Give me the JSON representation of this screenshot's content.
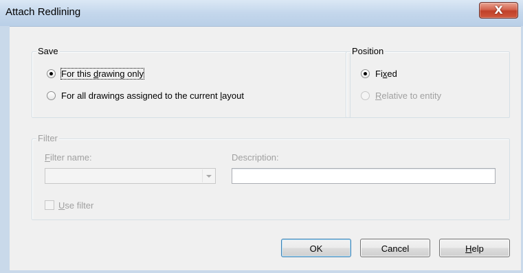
{
  "window": {
    "title": "Attach Redlining",
    "close_glyph": "X"
  },
  "save_group": {
    "legend": "Save",
    "option1": {
      "prefix": "For this ",
      "accel": "d",
      "suffix": "rawing only",
      "checked": true
    },
    "option2": {
      "prefix": "For all drawings assigned to the current ",
      "accel": "l",
      "suffix": "ayout",
      "checked": false
    }
  },
  "position_group": {
    "legend": "Position",
    "option1": {
      "prefix": "Fi",
      "accel": "x",
      "suffix": "ed",
      "checked": true,
      "enabled": true
    },
    "option2": {
      "prefix": "",
      "accel": "R",
      "suffix": "elative to entity",
      "checked": false,
      "enabled": false
    }
  },
  "filter_group": {
    "legend": "Filter",
    "filter_name_label": {
      "accel": "F",
      "suffix": "ilter name:"
    },
    "filter_name_value": "",
    "description_label": "Description:",
    "description_value": "",
    "use_filter": {
      "accel": "U",
      "suffix": "se filter",
      "checked": false,
      "enabled": false
    }
  },
  "buttons": {
    "ok": "OK",
    "cancel": "Cancel",
    "help": {
      "accel": "H",
      "suffix": "elp"
    }
  },
  "icons": {
    "close": "close-icon",
    "combo_arrow": "chevron-down-icon"
  },
  "colors": {
    "titlebar": "#c4d7ec",
    "close_button": "#c9462c",
    "dialog_background": "#f0f0f0",
    "disabled_text": "#a0a0a0"
  }
}
